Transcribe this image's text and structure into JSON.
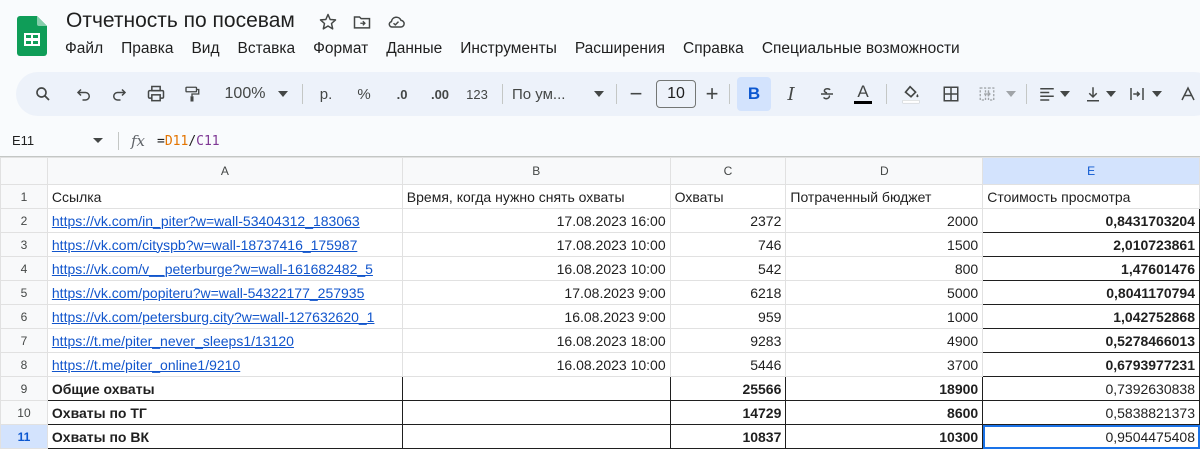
{
  "app": {
    "title": "Отчетность по посевам",
    "brand_color": "#0f9d58"
  },
  "title_icons": [
    "star-icon",
    "move-to-folder-icon",
    "cloud-status-icon"
  ],
  "menu": [
    "Файл",
    "Правка",
    "Вид",
    "Вставка",
    "Формат",
    "Данные",
    "Инструменты",
    "Расширения",
    "Справка",
    "Специальные возможности"
  ],
  "toolbar": {
    "zoom": "100%",
    "currency": "р.",
    "percent": "%",
    "dec_decrease": ".0",
    "dec_increase": ".00",
    "more_formats": "123",
    "font_name": "По ум...",
    "font_size": "10",
    "bold": "B",
    "italic": "I",
    "text_color_label": "A"
  },
  "formula_bar": {
    "cell_ref": "E11",
    "fx_label": "fx",
    "formula_eq": "=",
    "formula_ref1": "D11",
    "formula_op": "/",
    "formula_ref2": "C11"
  },
  "columns": [
    "A",
    "B",
    "C",
    "D",
    "E"
  ],
  "selected_column": "E",
  "selected_row": "11",
  "rows": [
    {
      "n": "1",
      "a": "Ссылка",
      "b": "Время, когда нужно снять охваты",
      "c": "Охваты",
      "d": "Потраченный бюджет",
      "e": "Стоимость просмотра",
      "type": "header"
    },
    {
      "n": "2",
      "a": "https://vk.com/in_piter?w=wall-53404312_183063",
      "b": "17.08.2023 16:00",
      "c": "2372",
      "d": "2000",
      "e": "0,8431703204",
      "type": "link"
    },
    {
      "n": "3",
      "a": "https://vk.com/cityspb?w=wall-18737416_175987",
      "b": "17.08.2023 10:00",
      "c": "746",
      "d": "1500",
      "e": "2,010723861",
      "type": "link"
    },
    {
      "n": "4",
      "a": "https://vk.com/v__peterburge?w=wall-161682482_5",
      "b": "16.08.2023 10:00",
      "c": "542",
      "d": "800",
      "e": "1,47601476",
      "type": "link"
    },
    {
      "n": "5",
      "a": "https://vk.com/popiteru?w=wall-54322177_257935",
      "b": "17.08.2023 9:00",
      "c": "6218",
      "d": "5000",
      "e": "0,8041170794",
      "type": "link"
    },
    {
      "n": "6",
      "a": "https://vk.com/petersburg.city?w=wall-127632620_1",
      "b": "16.08.2023 9:00",
      "c": "959",
      "d": "1000",
      "e": "1,042752868",
      "type": "link"
    },
    {
      "n": "7",
      "a": "https://t.me/piter_never_sleeps1/13120",
      "b": "16.08.2023 18:00",
      "c": "9283",
      "d": "4900",
      "e": "0,5278466013",
      "type": "link"
    },
    {
      "n": "8",
      "a": "https://t.me/piter_online1/9210",
      "b": "16.08.2023 10:00",
      "c": "5446",
      "d": "3700",
      "e": "0,6793977231",
      "type": "link"
    },
    {
      "n": "9",
      "a": "Общие охваты",
      "b": "",
      "c": "25566",
      "d": "18900",
      "e": "0,7392630838",
      "type": "summary"
    },
    {
      "n": "10",
      "a": "Охваты по ТГ",
      "b": "",
      "c": "14729",
      "d": "8600",
      "e": "0,5838821373",
      "type": "summary"
    },
    {
      "n": "11",
      "a": "Охваты по ВК",
      "b": "",
      "c": "10837",
      "d": "10300",
      "e": "0,9504475408",
      "type": "summary"
    }
  ]
}
